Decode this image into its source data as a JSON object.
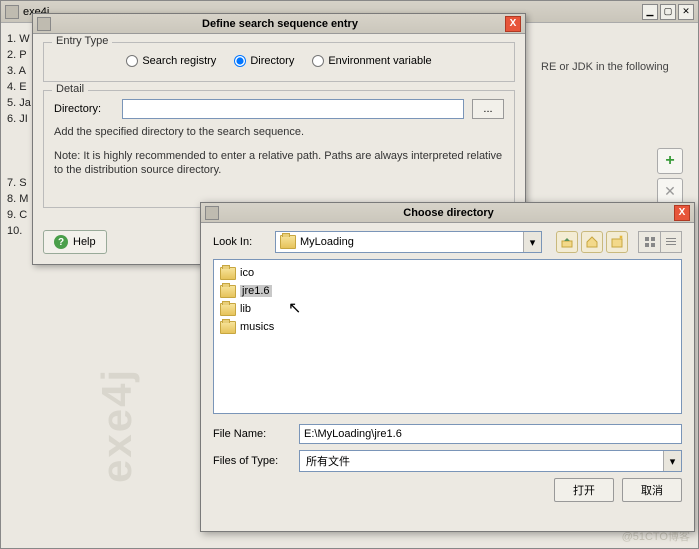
{
  "main": {
    "title": "exe4j",
    "left_list": [
      "1. W",
      "2. P",
      "3. A",
      "4. E",
      "5. Ja",
      "6. JI",
      "7. S",
      "8. M",
      "9. C",
      "10."
    ],
    "bg_text": "RE or JDK in the following",
    "watermark": "exe4j",
    "copyright": "@51CTO博客"
  },
  "dlg1": {
    "title": "Define search sequence entry",
    "entry_type_legend": "Entry Type",
    "radio_registry": "Search registry",
    "radio_directory": "Directory",
    "radio_env": "Environment variable",
    "detail_legend": "Detail",
    "dir_label": "Directory:",
    "dir_value": "",
    "browse": "...",
    "msg1": "Add the specified directory to the search sequence.",
    "msg2": "Note: It is highly recommended to enter a relative path. Paths are always interpreted relative to the distribution source directory.",
    "help": "Help"
  },
  "dlg2": {
    "title": "Choose directory",
    "look_in": "Look In:",
    "look_value": "MyLoading",
    "files": [
      {
        "name": "ico",
        "sel": false
      },
      {
        "name": "jre1.6",
        "sel": true
      },
      {
        "name": "lib",
        "sel": false
      },
      {
        "name": "musics",
        "sel": false
      }
    ],
    "filename_label": "File Name:",
    "filename_value": "E:\\MyLoading\\jre1.6",
    "type_label": "Files of Type:",
    "type_value": "所有文件",
    "open": "打开",
    "cancel": "取消"
  }
}
